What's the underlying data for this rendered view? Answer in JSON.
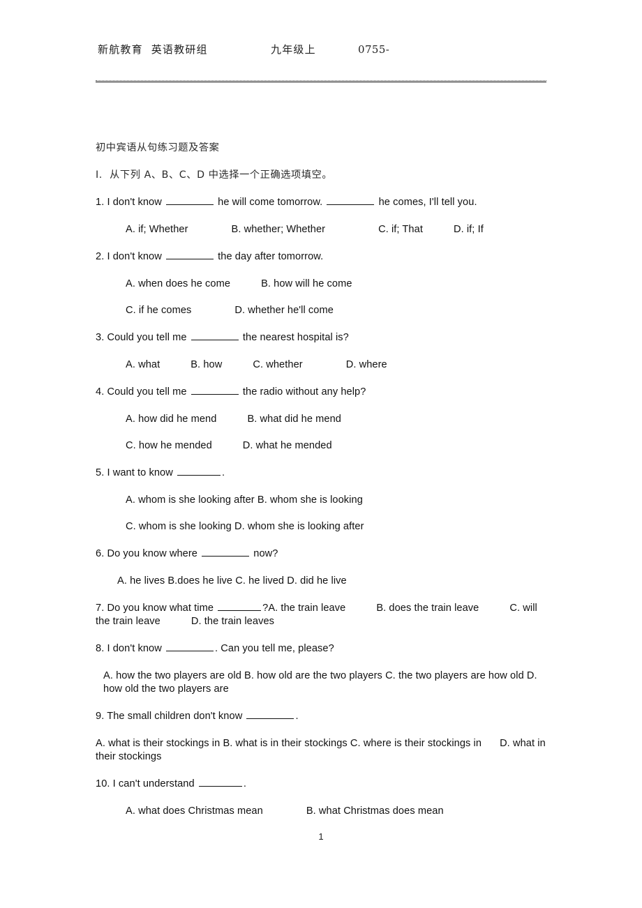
{
  "header": {
    "organization": "新航教育  英语教研组",
    "grade": "九年级上",
    "phone": "0755-"
  },
  "document": {
    "title": "初中宾语从句练习题及答案",
    "section_instruction": "I.  从下列 A、B、C、D 中选择一个正确选项填空。"
  },
  "questions": [
    {
      "stem_a": "1. I don't know",
      "stem_b": "he will come tomorrow.",
      "stem_c": "he comes, I'll tell you.",
      "options": {
        "a": "A. if; Whether",
        "b": "B. whether; Whether",
        "c": "C. if; That",
        "d": "D. if; If"
      }
    },
    {
      "stem_a": "2. I don't know",
      "stem_b": "the day after tomorrow.",
      "options": {
        "a": "A. when does he come",
        "b": "B. how will he come",
        "c": "C. if he comes",
        "d": "D. whether he'll come"
      }
    },
    {
      "stem_a": "3. Could you tell me",
      "stem_b": "the nearest hospital is?",
      "options": {
        "a": "A. what",
        "b": "B. how",
        "c": "C. whether",
        "d": "D. where"
      }
    },
    {
      "stem_a": "4. Could you tell me",
      "stem_b": "the radio without any help?",
      "options": {
        "a": "A. how did he mend",
        "b": "B. what did he mend",
        "c": "C. how he mended",
        "d": "D. what he mended"
      }
    },
    {
      "stem_a": "5. I want to know",
      "stem_b": ".",
      "options": {
        "ab": "A. whom is she looking after B. whom she is looking",
        "cd": "C. whom is she looking D. whom she is looking after"
      }
    },
    {
      "stem_a": "6. Do you know where",
      "stem_b": "now?",
      "options": {
        "all": "A. he lives B.does he live C. he lived D. did he live"
      }
    },
    {
      "stem_a": "7. Do you know what time",
      "stem_b": "?A. the train leave",
      "options": {
        "b": "B. does the train leave",
        "c": "C. will the train leave",
        "d": "D. the train leaves"
      }
    },
    {
      "stem_a": "8. I don't know",
      "stem_b": ". Can you tell me, please?",
      "options": {
        "abc": "A. how the two players are old B. how old are the two players C. the two players are how old",
        "d": "D. how old the two players are"
      }
    },
    {
      "stem_a": "9. The small children don't know",
      "stem_b": ".",
      "options": {
        "abc": "A. what is their stockings in B. what is in their stockings C. where is their stockings in",
        "d_head": "D. what",
        "d_tail": "in their stockings"
      }
    },
    {
      "stem_a": "10. I can't understand",
      "stem_b": ".",
      "options": {
        "a": "A. what does Christmas mean",
        "b": "B. what Christmas does mean"
      }
    }
  ],
  "footer": {
    "page_number": "1"
  }
}
